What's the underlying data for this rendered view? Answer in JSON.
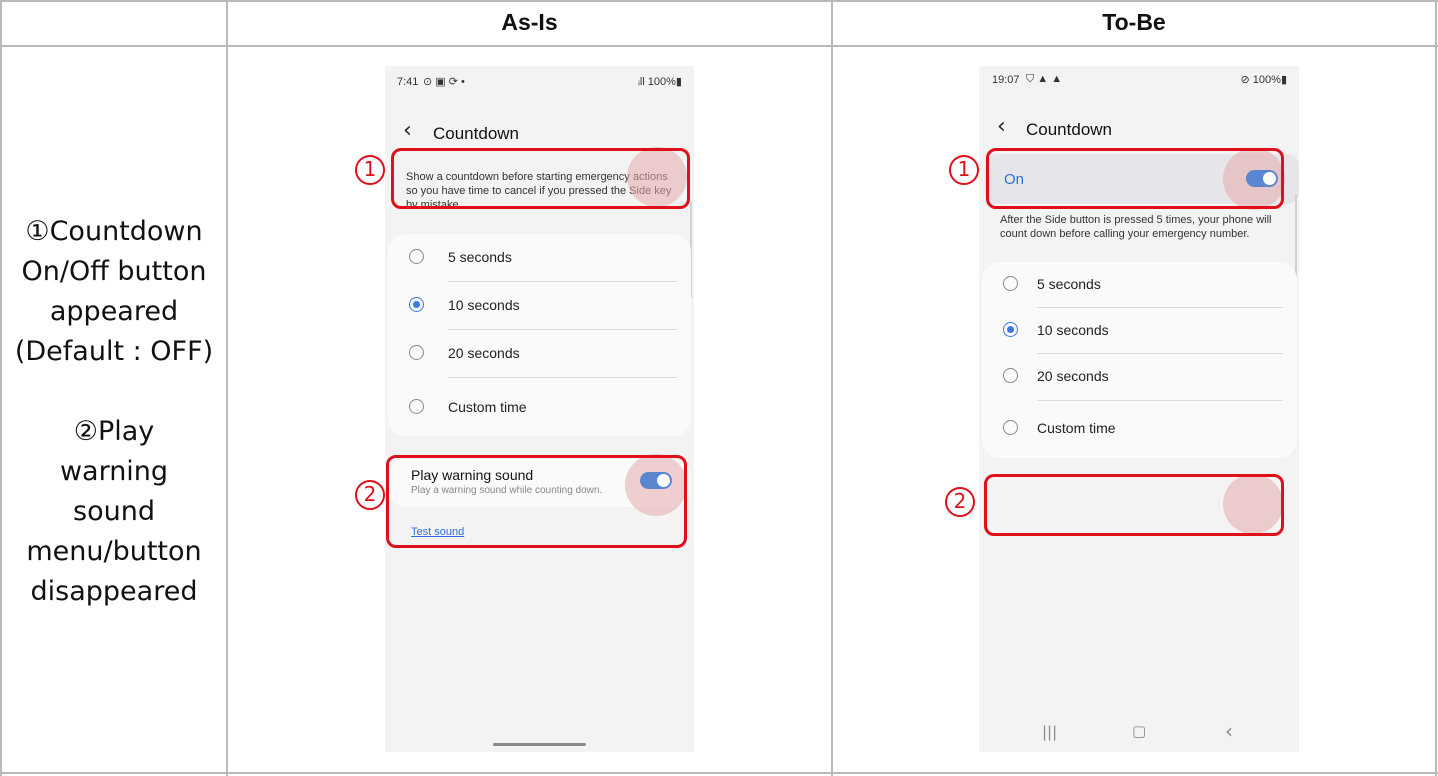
{
  "table": {
    "col_asis": "As-Is",
    "col_tobe": "To-Be",
    "note": {
      "line1": "①Countdown",
      "line2": "On/Off button",
      "line3": "appeared",
      "line4": "(Default : OFF)",
      "line5": "②Play",
      "line6": "warning",
      "line7": "sound",
      "line8": "menu/button",
      "line9": "disappeared"
    }
  },
  "asis": {
    "status_time": "7:41",
    "status_icons": "⊙ ▣ ⟳  •",
    "status_right": "ᵢll 100%▮",
    "title": "Countdown",
    "description": "Show a countdown before starting emergency actions so you have time to cancel if you pressed the Side key by mistake.",
    "options": [
      "5 seconds",
      "10 seconds",
      "20 seconds",
      "Custom time"
    ],
    "selected_index": 1,
    "warning_title": "Play warning sound",
    "warning_sub": "Play a warning sound while counting down.",
    "warning_toggle_on": true,
    "test_sound": "Test sound",
    "badge1": "1",
    "badge2": "2"
  },
  "tobe": {
    "status_time": "19:07",
    "status_icons": "⛉ ▲ ▲",
    "status_right": "⊘ 100%▮",
    "title": "Countdown",
    "on_label": "On",
    "toggle_on": true,
    "description": "After the Side button is pressed 5 times, your phone will count down before calling your emergency number.",
    "options": [
      "5 seconds",
      "10 seconds",
      "20 seconds",
      "Custom time"
    ],
    "selected_index": 1,
    "nav_recent": "|||",
    "nav_home": "▢",
    "nav_back": "‹",
    "badge1": "1",
    "badge2": "2"
  },
  "colors": {
    "highlight": "#e0101a",
    "accent": "#3a78e7",
    "toggle": "#5a86cf"
  }
}
